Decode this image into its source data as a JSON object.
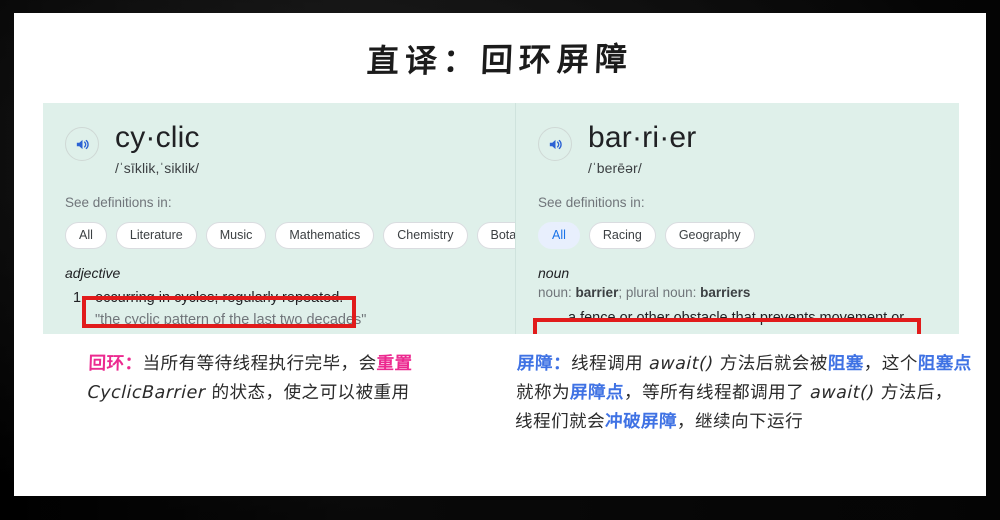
{
  "title": "直译：回环屏障",
  "dictionary": {
    "left": {
      "audio_icon": "speaker-icon",
      "headword": "cy·clic",
      "phonetic": "/ˈsīklik,ˈsiklik/",
      "see_definitions_label": "See definitions in:",
      "chips": [
        {
          "label": "All",
          "selected": false
        },
        {
          "label": "Literature",
          "selected": false
        },
        {
          "label": "Music",
          "selected": false
        },
        {
          "label": "Mathematics",
          "selected": false
        },
        {
          "label": "Chemistry",
          "selected": false
        },
        {
          "label": "Botany",
          "selected": false
        }
      ],
      "part_of_speech": "adjective",
      "sense_number": "1.",
      "sense_text": "occurring in cycles; regularly repeated.",
      "sense_example": "\"the cyclic pattern of the last two decades\"",
      "highlight_color": "#e11b1b"
    },
    "right": {
      "audio_icon": "speaker-icon",
      "headword": "bar·ri·er",
      "phonetic": "/ˈberēər/",
      "see_definitions_label": "See definitions in:",
      "chips": [
        {
          "label": "All",
          "selected": true
        },
        {
          "label": "Racing",
          "selected": false
        },
        {
          "label": "Geography",
          "selected": false
        }
      ],
      "part_of_speech": "noun",
      "inflection_prefix": "noun: ",
      "inflection_word": "barrier",
      "inflection_middle": "; plural noun: ",
      "inflection_plural": "barriers",
      "sense_text": "a fence or other obstacle that prevents movement or access.",
      "highlight_color": "#e11b1b"
    }
  },
  "notes": {
    "left": {
      "line1_key": "回环",
      "line1_colon": "：",
      "line1_a": "当所有等待线程执行完毕，会",
      "line1_key2": "重置",
      "line2_code": "CyclicBarrier",
      "line2_text": " 的状态，使之可以被重用",
      "accent_color": "#ec2a90"
    },
    "right": {
      "key": "屏障",
      "colon": "：",
      "seg1": "线程调用 ",
      "code1": "await()",
      "seg2": " 方法后就会被",
      "kw1": "阻塞",
      "seg3": "，这个",
      "kw2": "阻塞点",
      "seg4": "就称为",
      "kw3": "屏障点",
      "seg5": "，等所有线程都调用了 ",
      "code2": "await()",
      "seg6": " 方法后， 线程们就会",
      "kw4": "冲破屏障",
      "seg7": "，继续向下运行",
      "accent_color": "#3f72e4"
    }
  },
  "colors": {
    "card_background": "#dff0ea",
    "page_background": "#ffffff",
    "frame": "#000000",
    "chip_selected_bg": "#e8effd",
    "chip_selected_text": "#1a73e8",
    "audio_icon_color": "#2b62d4"
  }
}
